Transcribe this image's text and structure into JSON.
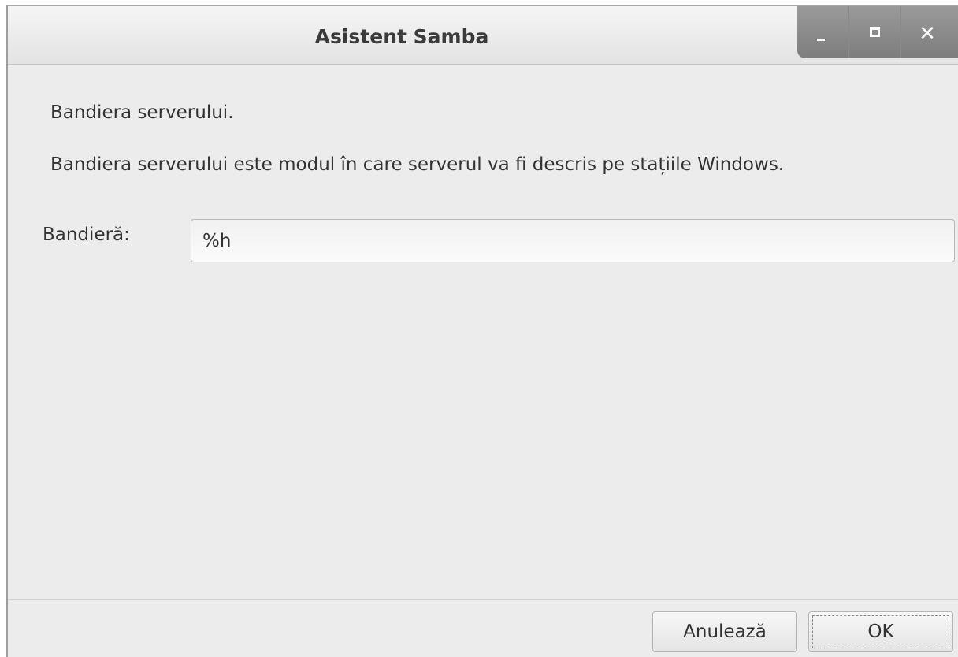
{
  "window": {
    "title": "Asistent Samba",
    "controls": {
      "minimize_icon": "minimize-icon",
      "maximize_icon": "maximize-icon",
      "close_icon": "close-icon",
      "close_glyph": "✕"
    }
  },
  "content": {
    "heading": "Bandiera serverului.",
    "description": "Bandiera serverului este modul în care serverul va fi descris pe stațiile Windows.",
    "banner_field": {
      "label": "Bandieră:",
      "value": "%h"
    }
  },
  "footer": {
    "cancel_label": "Anulează",
    "ok_label": "OK"
  }
}
